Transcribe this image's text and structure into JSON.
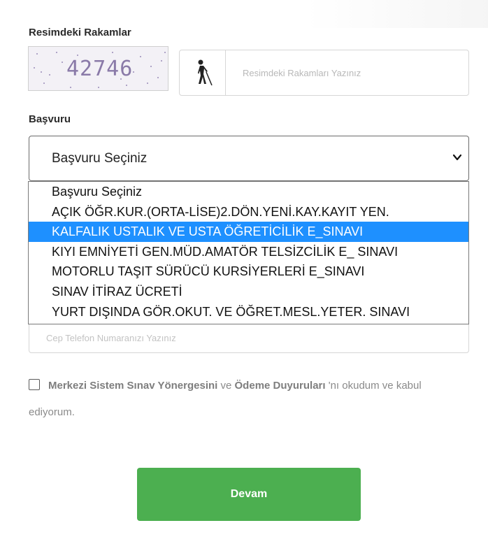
{
  "captcha": {
    "label": "Resimdeki Rakamlar",
    "code": "42746",
    "placeholder": "Resimdeki Rakamları Yazınız",
    "accessibility_icon": "blind-person-icon"
  },
  "application": {
    "label": "Başvuru",
    "selected": "Başvuru Seçiniz",
    "options": [
      "Başvuru Seçiniz",
      "AÇIK ÖĞR.KUR.(ORTA-LİSE)2.DÖN.YENİ.KAY.KAYIT YEN.",
      "KALFALIK USTALIK VE USTA ÖĞRETİCİLİK E_SINAVI",
      "KIYI EMNİYETİ GEN.MÜD.AMATÖR TELSİZCİLİK E_ SINAVI",
      "MOTORLU TAŞIT SÜRÜCÜ KURSİYERLERİ E_SINAVI",
      "SINAV İTİRAZ ÜCRETİ",
      "YURT DIŞINDA GÖR.OKUT. VE ÖĞRET.MESL.YETER. SINAVI"
    ],
    "highlighted_index": 2
  },
  "phone": {
    "placeholder": "Cep Telefon Numaranızı Yazınız"
  },
  "consent": {
    "bold_1": "Merkezi Sistem Sınav Yönergesini",
    "mid": " ve ",
    "bold_2": "Ödeme Duyuruları",
    "tail": " 'nı okudum ve kabul ediyorum."
  },
  "submit": {
    "label": "Devam"
  },
  "colors": {
    "accent": "#4caf50",
    "highlight": "#1e90ff"
  }
}
